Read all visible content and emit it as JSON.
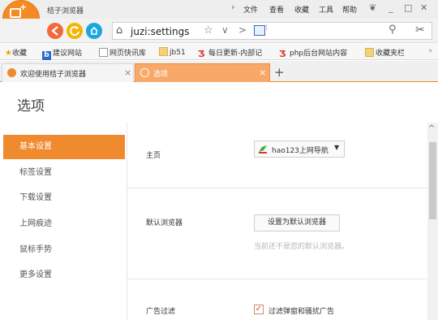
{
  "window": {
    "logo_text": "orange",
    "app_title": "桔子浏览器",
    "menu": [
      "文件",
      "查看",
      "收藏",
      "工具",
      "帮助"
    ],
    "controls": {
      "min": "_",
      "max": "□",
      "close": "✕"
    }
  },
  "nav": {
    "url": "juzi:settings",
    "colors": {
      "back": "#f26a3b",
      "refresh": "#f5b400",
      "home": "#1aa7e0"
    }
  },
  "bookmarks": [
    {
      "label": "收藏",
      "icon": "star-icon"
    },
    {
      "label": "建议网站",
      "icon": "b-icon"
    },
    {
      "label": "网页快讯库",
      "icon": "page-icon"
    },
    {
      "label": "jb51",
      "icon": "folder-icon"
    },
    {
      "label": "每日更新-内部记",
      "icon": "logo-icon"
    },
    {
      "label": "php后台网站内容",
      "icon": "logo-icon"
    },
    {
      "label": "收藏夹栏",
      "icon": "folder-icon"
    }
  ],
  "tabs": [
    {
      "label": "欢迎使用桔子浏览器",
      "active": false
    },
    {
      "label": "选项",
      "active": true
    }
  ],
  "page": {
    "title": "选项",
    "sidebar": [
      "基本设置",
      "标签设置",
      "下载设置",
      "上网痕迹",
      "鼠标手势",
      "更多设置"
    ],
    "active_index": 0,
    "settings": {
      "homepage_label": "主页",
      "homepage_value": "hao123上网导航",
      "default_browser_label": "默认浏览器",
      "default_browser_button": "设置为默认浏览器",
      "default_browser_hint": "当前还不是您的默认浏览器。",
      "ads_label": "广告过滤",
      "ads_checkbox_label": "过滤弹窗和骚扰广告",
      "ads_checked": true
    }
  }
}
